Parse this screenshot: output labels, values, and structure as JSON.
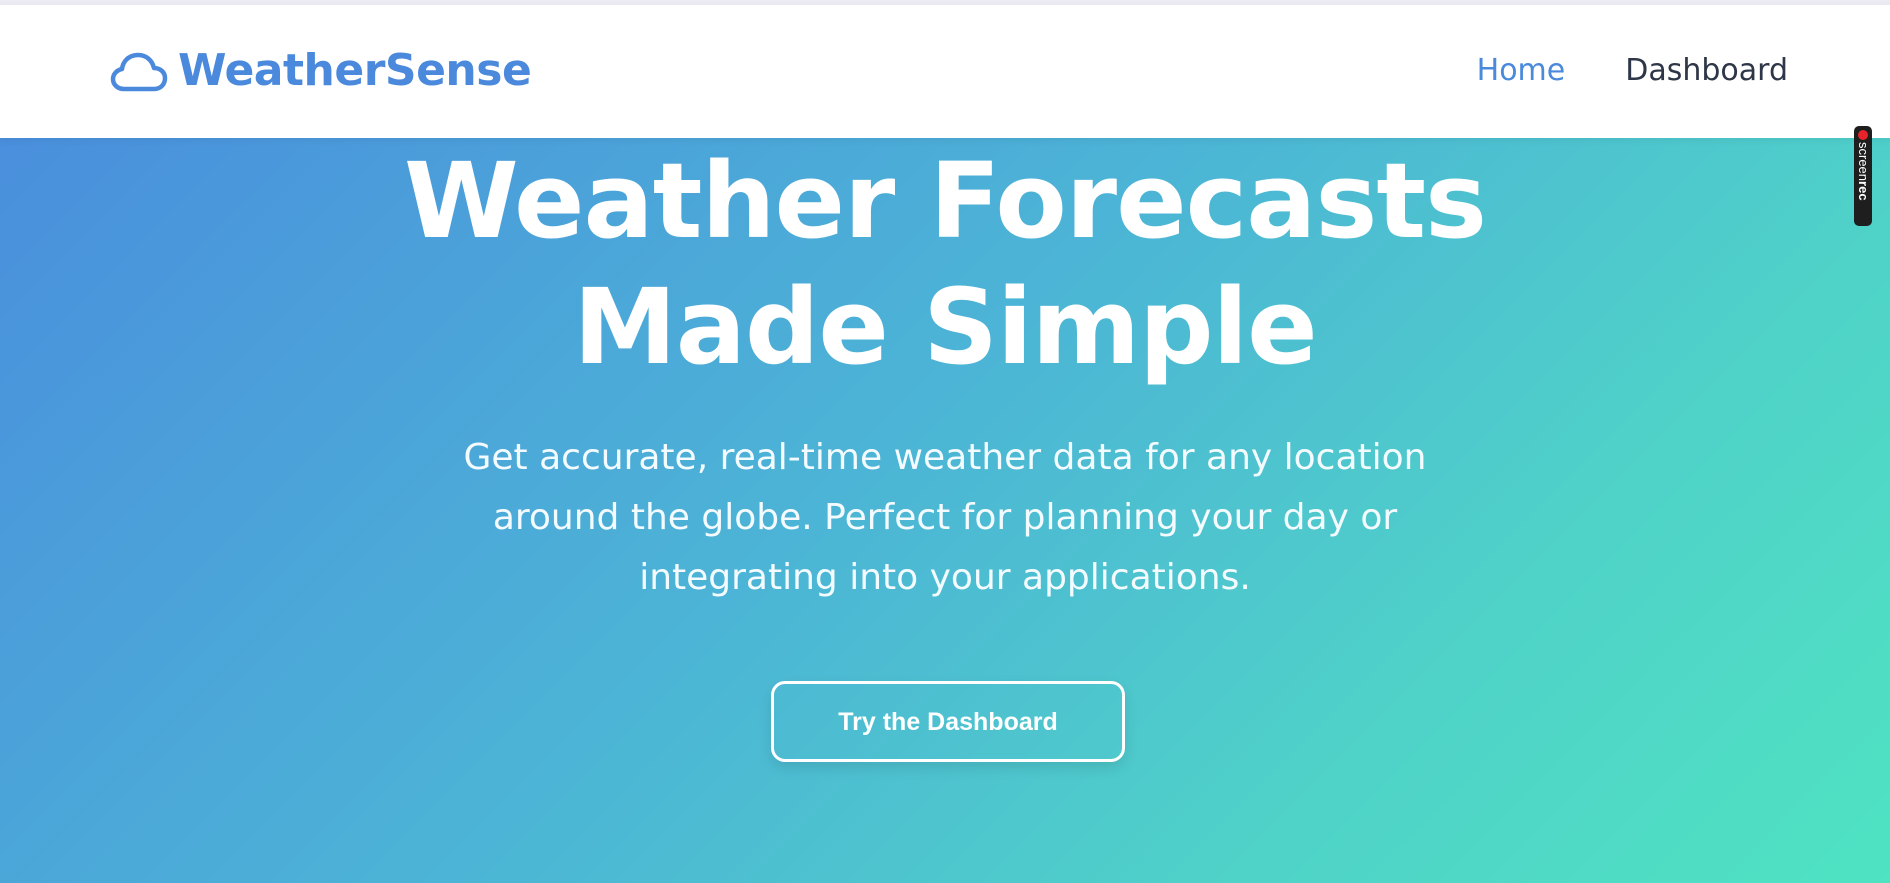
{
  "brand": {
    "name": "WeatherSense",
    "icon": "cloud-icon",
    "color": "#4a89dc"
  },
  "nav": {
    "items": [
      {
        "label": "Home",
        "active": true
      },
      {
        "label": "Dashboard",
        "active": false
      }
    ]
  },
  "hero": {
    "title_line1": "Weather Forecasts",
    "title_line2": "Made Simple",
    "subtitle": "Get accurate, real-time weather data for any location around the globe. Perfect for planning your day or integrating into your applications.",
    "cta_label": "Try the Dashboard",
    "gradient": [
      "#4a8fdd",
      "#4fe3c2"
    ]
  },
  "overlay": {
    "recorder_part1": "screen",
    "recorder_part2": "rec"
  }
}
